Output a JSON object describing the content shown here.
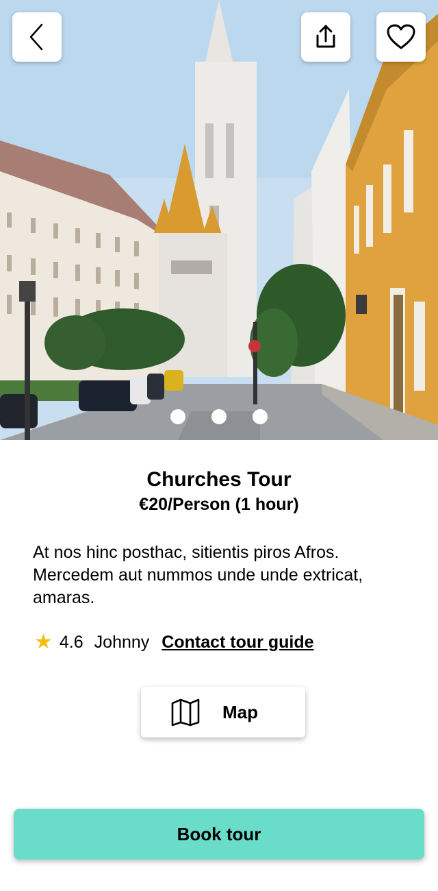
{
  "hero": {
    "photo_subject": "church-street-photo",
    "slide_count": 3
  },
  "toolbar": {
    "back_icon": "chevron-left-icon",
    "share_icon": "share-icon",
    "favorite_icon": "heart-icon"
  },
  "tour": {
    "title": "Churches Tour",
    "price": "€20/Person (1 hour)",
    "description": "At nos hinc posthac, sitientis piros Afros. Mercedem aut nummos unde unde extricat, amaras.",
    "rating": "4.6",
    "guide_name": "Johnny",
    "contact_label": "Contact tour guide"
  },
  "actions": {
    "map_label": "Map",
    "map_icon": "map-icon",
    "book_label": "Book tour"
  },
  "colors": {
    "accent": "#6addca",
    "star": "#f5be0b"
  }
}
